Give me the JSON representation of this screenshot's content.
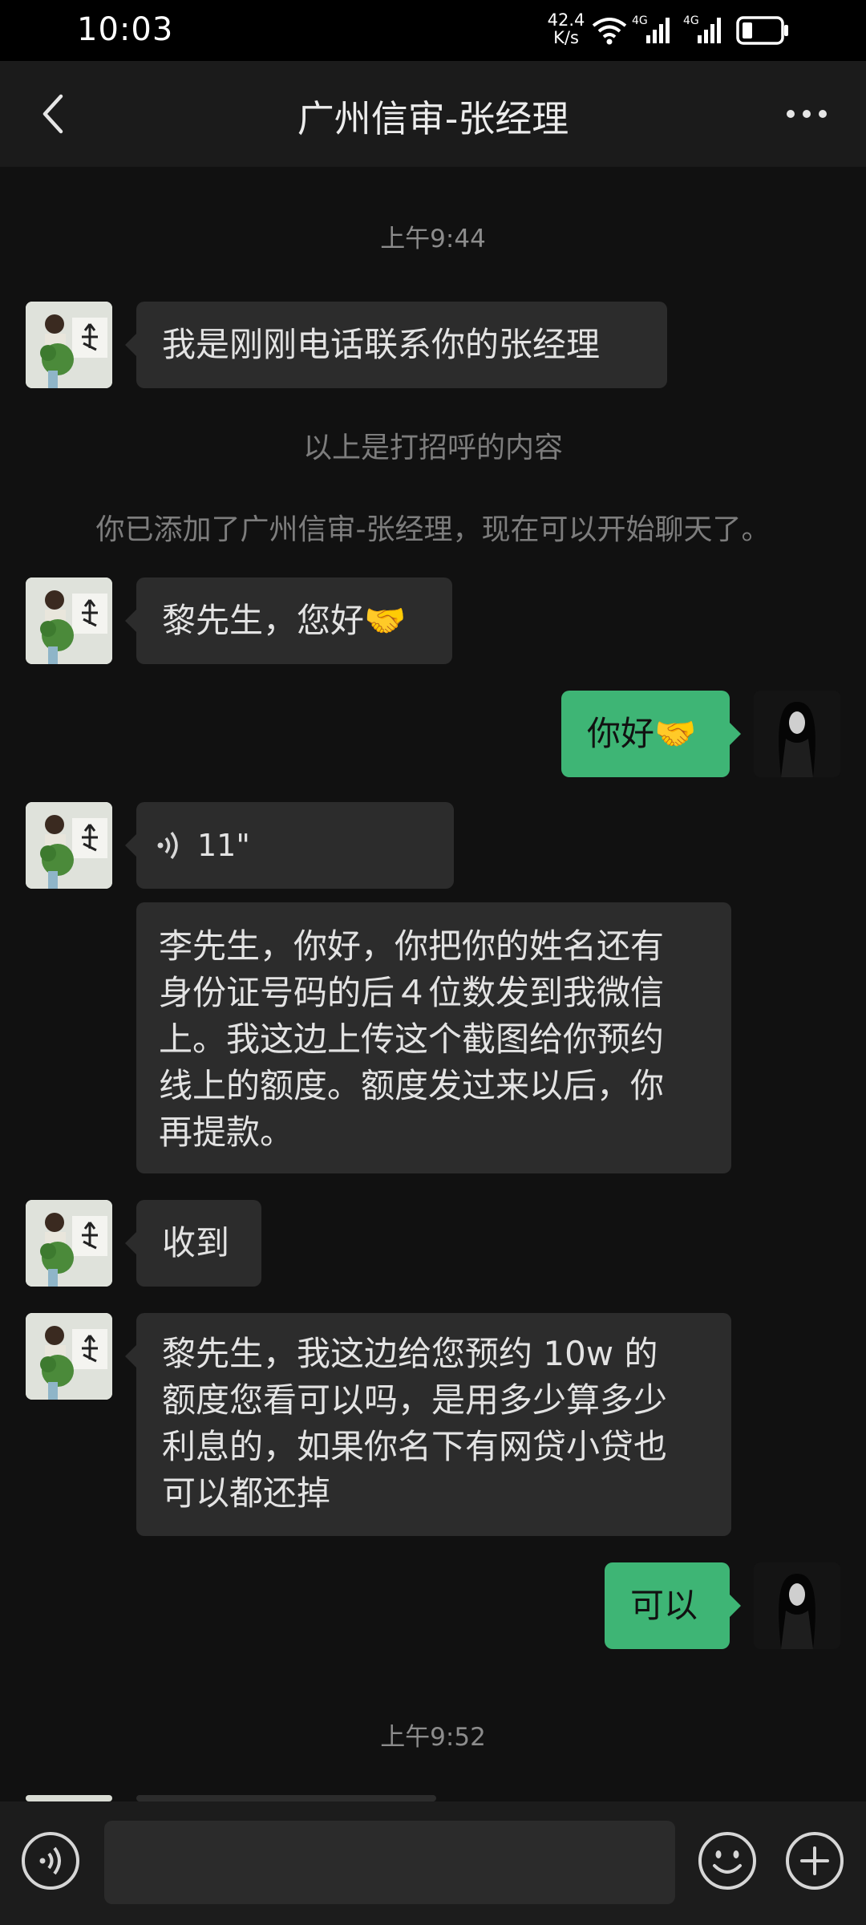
{
  "status_bar": {
    "time": "10:03",
    "net_speed_value": "42.4",
    "net_speed_unit": "K/s",
    "signal_1_label": "4G",
    "signal_2_label": "4G"
  },
  "nav": {
    "title": "广州信审-张经理"
  },
  "chat": {
    "timestamp_1": "上午9:44",
    "msg_greeting": "我是刚刚电话联系你的张经理",
    "note_greeting": "以上是打招呼的内容",
    "note_added": "你已添加了广州信审-张经理，现在可以开始聊天了。",
    "msg_hello_in": "黎先生，您好🤝",
    "msg_hello_out": "你好🤝",
    "voice_duration": "11\"",
    "msg_voice_text_line_1": "李先生，你好，你把你的姓名还有",
    "msg_voice_text_line_2": "身份证号码的后４位数发到我微信",
    "msg_voice_text_line_3": "上。我这边上传这个截图给你预约",
    "msg_voice_text_line_4": "线上的额度。额度发过来以后，你",
    "msg_voice_text_line_5": "再提款。",
    "msg_received": "收到",
    "msg_offer_line_1": "黎先生，我这边给您预约 10w 的",
    "msg_offer_line_2": "额度您看可以吗，是用多少算多少",
    "msg_offer_line_3": "利息的，如果你名下有网贷小贷也",
    "msg_offer_line_4": "可以都还掉",
    "msg_ok_out": "可以",
    "timestamp_2": "上午9:52"
  },
  "input_bar": {
    "message_value": ""
  },
  "colors": {
    "background": "#111111",
    "nav_bar": "#1b1b1b",
    "incoming_bubble": "#2c2c2c",
    "outgoing_bubble": "#3eb575",
    "input_bar": "#1c1c1c"
  },
  "icons": {
    "back": "back-arrow-icon",
    "more": "more-dots-icon",
    "voice_toggle": "voice-mode-icon",
    "emoji": "emoji-icon",
    "plus": "plus-icon"
  }
}
